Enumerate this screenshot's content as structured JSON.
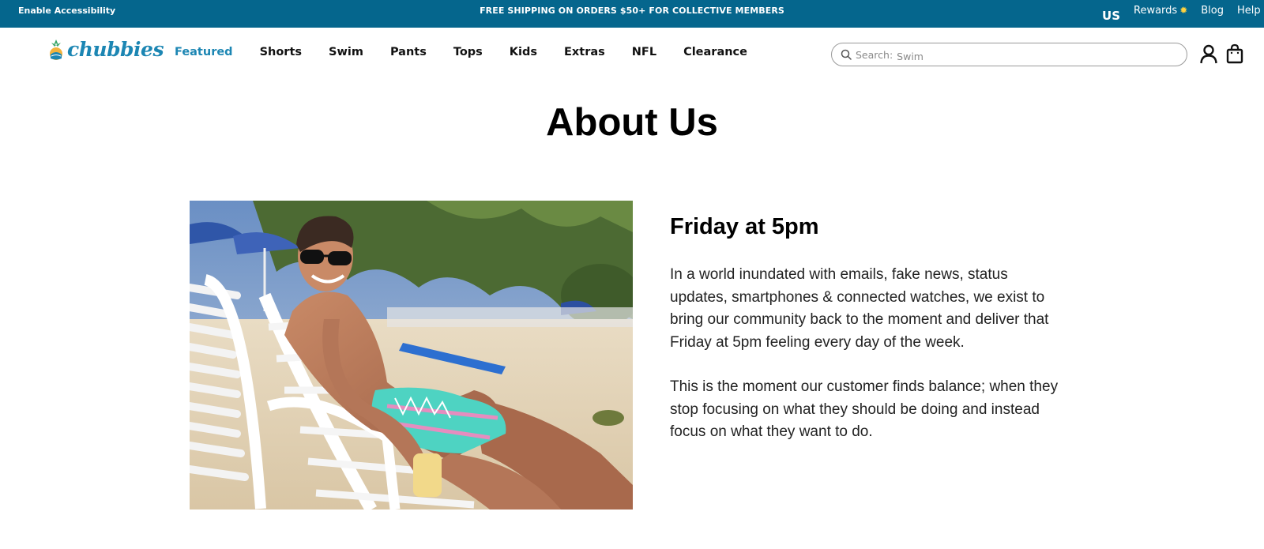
{
  "topbar": {
    "accessibility": "Enable Accessibility",
    "promo": "FREE SHIPPING ON ORDERS $50+ FOR COLLECTIVE MEMBERS",
    "region": "US",
    "links": {
      "rewards": "Rewards",
      "blog": "Blog",
      "help": "Help"
    }
  },
  "header": {
    "logo_text": "chubbies",
    "nav": [
      "Featured",
      "Shorts",
      "Swim",
      "Pants",
      "Tops",
      "Kids",
      "Extras",
      "NFL",
      "Clearance"
    ],
    "search": {
      "label": "Search:",
      "placeholder": "Swim"
    },
    "icons": [
      "search-icon",
      "account-icon",
      "shopping-bag-icon"
    ]
  },
  "page": {
    "title": "About Us",
    "section_title": "Friday at 5pm",
    "paragraphs": [
      "In a world inundated with emails, fake news, status updates, smartphones & connected watches, we exist to bring our community back to the moment and deliver that Friday at 5pm feeling every day of the week.",
      "This is the moment our customer finds balance; when they stop focusing on what they should be doing and instead focus on what they want to do."
    ]
  },
  "colors": {
    "topbar_bg": "#05668d",
    "brand_blue": "#1c86b3",
    "text": "#111111"
  }
}
